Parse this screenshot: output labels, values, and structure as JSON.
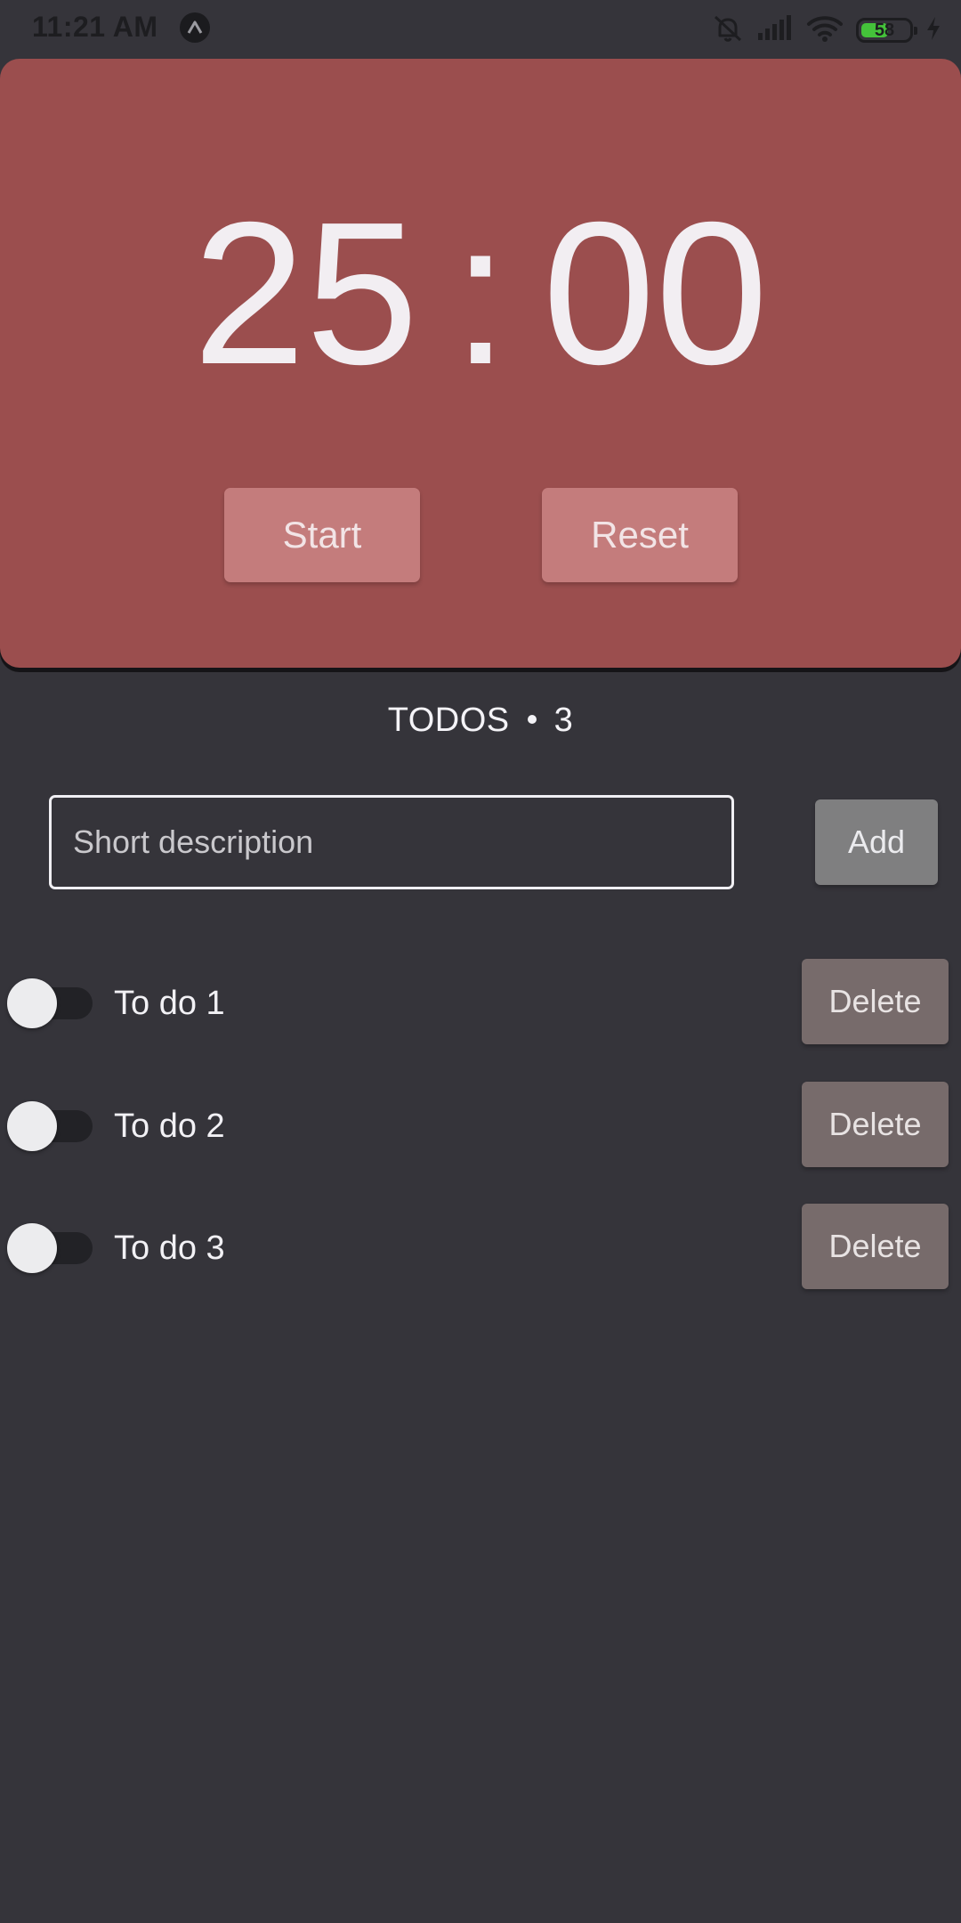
{
  "status_bar": {
    "time": "11:21 AM",
    "battery": "58",
    "icons": [
      "app-badge-icon",
      "mute-icon",
      "signal-icon",
      "wifi-icon",
      "battery-icon",
      "charging-icon"
    ]
  },
  "timer": {
    "minutes": "25",
    "separator": ":",
    "seconds": "00",
    "start_label": "Start",
    "reset_label": "Reset",
    "card_color": "#9b4e4e"
  },
  "todos": {
    "title": "TODOS",
    "count": "3",
    "input_placeholder": "Short description",
    "input_value": "",
    "add_label": "Add",
    "items": [
      {
        "label": "To do 1",
        "done": false,
        "delete_label": "Delete"
      },
      {
        "label": "To do 2",
        "done": false,
        "delete_label": "Delete"
      },
      {
        "label": "To do 3",
        "done": false,
        "delete_label": "Delete"
      }
    ]
  }
}
